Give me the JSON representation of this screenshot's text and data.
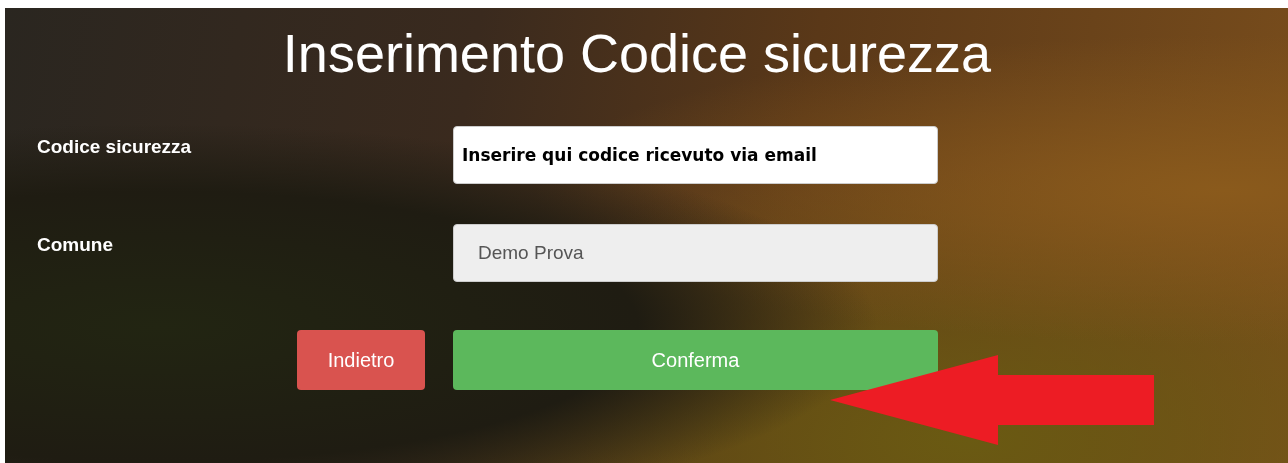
{
  "title": "Inserimento Codice sicurezza",
  "fields": [
    {
      "label": "Codice sicurezza",
      "value": "Inserire qui codice ricevuto via email",
      "disabled": false
    },
    {
      "label": "Comune",
      "value": "Demo Prova",
      "disabled": true
    }
  ],
  "buttons": [
    {
      "label": "Indietro",
      "kind": "danger"
    },
    {
      "label": "Conferma",
      "kind": "success"
    }
  ],
  "annotation": {
    "kind": "arrow",
    "color": "#ed1c24"
  }
}
